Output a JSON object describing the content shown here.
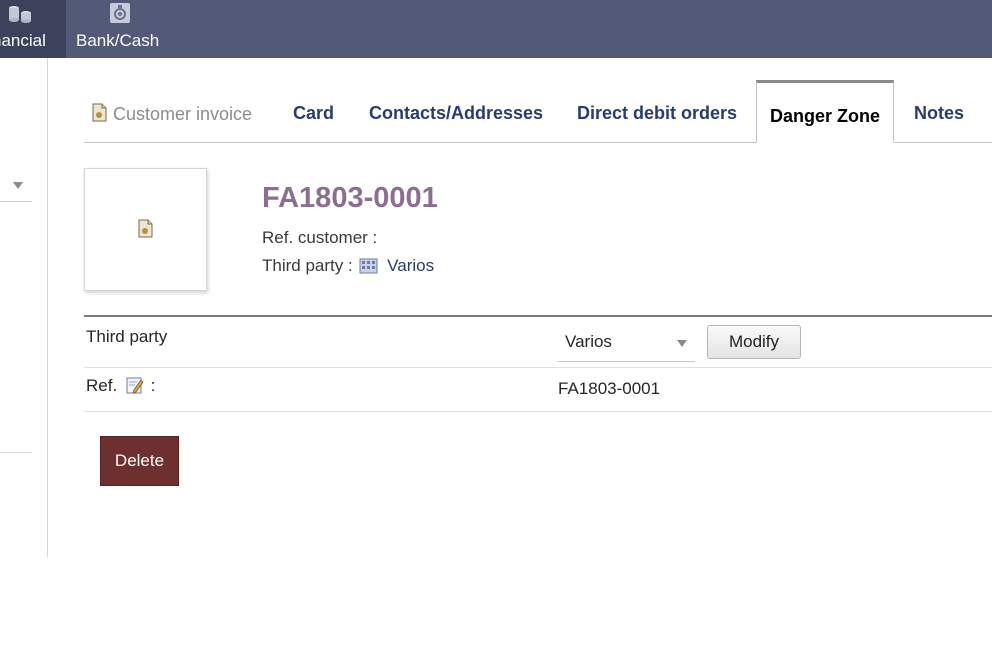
{
  "topmenu": {
    "items": [
      {
        "label": "nancial",
        "icon": "coins-icon",
        "active": true
      },
      {
        "label": "Bank/Cash",
        "icon": "bank-icon",
        "active": false
      }
    ]
  },
  "tabs": {
    "title": "Customer invoice",
    "items": [
      {
        "label": "Card",
        "active": false
      },
      {
        "label": "Contacts/Addresses",
        "active": false
      },
      {
        "label": "Direct debit orders",
        "active": false
      },
      {
        "label": "Danger Zone",
        "active": true
      },
      {
        "label": "Notes",
        "active": false
      }
    ]
  },
  "banner": {
    "ref": "FA1803-0001",
    "ref_customer_label": "Ref. customer :",
    "third_party_label": "Third party :",
    "third_party_name": "Varios"
  },
  "form": {
    "third_party_label": "Third party",
    "third_party_selected": "Varios",
    "modify_label": "Modify",
    "ref_label": "Ref.",
    "ref_colon": ":",
    "ref_value": "FA1803-0001"
  },
  "actions": {
    "delete_label": "Delete"
  },
  "colors": {
    "topbar": "#525a78",
    "topbar_active": "#3c425c",
    "tab_link": "#263c72",
    "ref_title": "#8a6f8f",
    "delete_button": "#6e2f2f"
  }
}
